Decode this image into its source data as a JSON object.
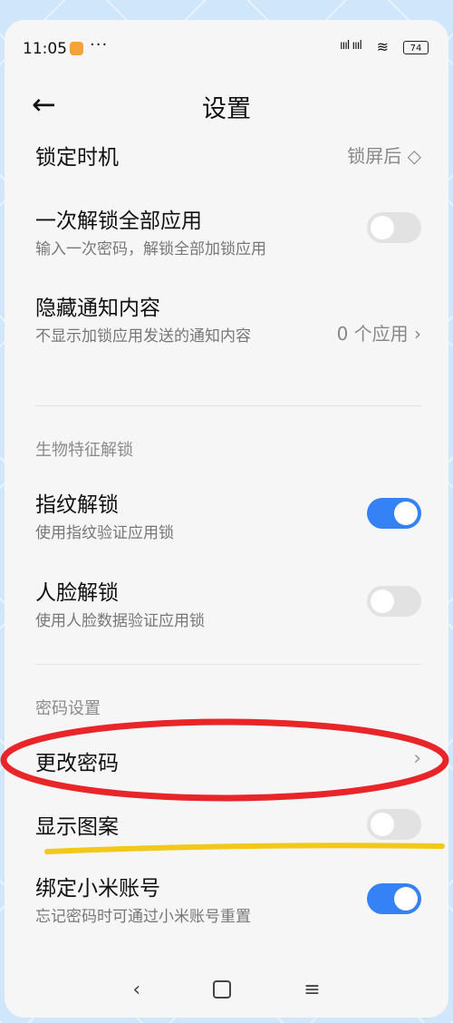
{
  "status": {
    "time": "11:05",
    "dots": "···",
    "signal": "ıııl ıııl",
    "wifi": "≋",
    "battery": "74"
  },
  "header": {
    "back_icon": "←",
    "title": "设置"
  },
  "lock_timing": {
    "label": "锁定时机",
    "value": "锁屏后 ◇"
  },
  "unlock_all": {
    "label": "一次解锁全部应用",
    "sub": "输入一次密码，解锁全部加锁应用",
    "enabled": false
  },
  "hide_notifications": {
    "label": "隐藏通知内容",
    "sub": "不显示加锁应用发送的通知内容",
    "value": "0 个应用 ›"
  },
  "biometric_section": {
    "title": "生物特征解锁",
    "fingerprint": {
      "label": "指纹解锁",
      "sub": "使用指纹验证应用锁",
      "enabled": true
    },
    "face": {
      "label": "人脸解锁",
      "sub": "使用人脸数据验证应用锁",
      "enabled": false
    }
  },
  "password_section": {
    "title": "密码设置",
    "change_password": {
      "label": "更改密码",
      "chevron": "›"
    },
    "show_pattern": {
      "label": "显示图案",
      "enabled": false
    },
    "bind_mi_account": {
      "label": "绑定小米账号",
      "sub": "忘记密码时可通过小米账号重置",
      "enabled": true
    }
  },
  "navbar": {
    "back": "‹",
    "menu": "≡"
  },
  "annotations": {
    "circle_color": "#e8262a",
    "underline_color": "#f2c81a"
  }
}
